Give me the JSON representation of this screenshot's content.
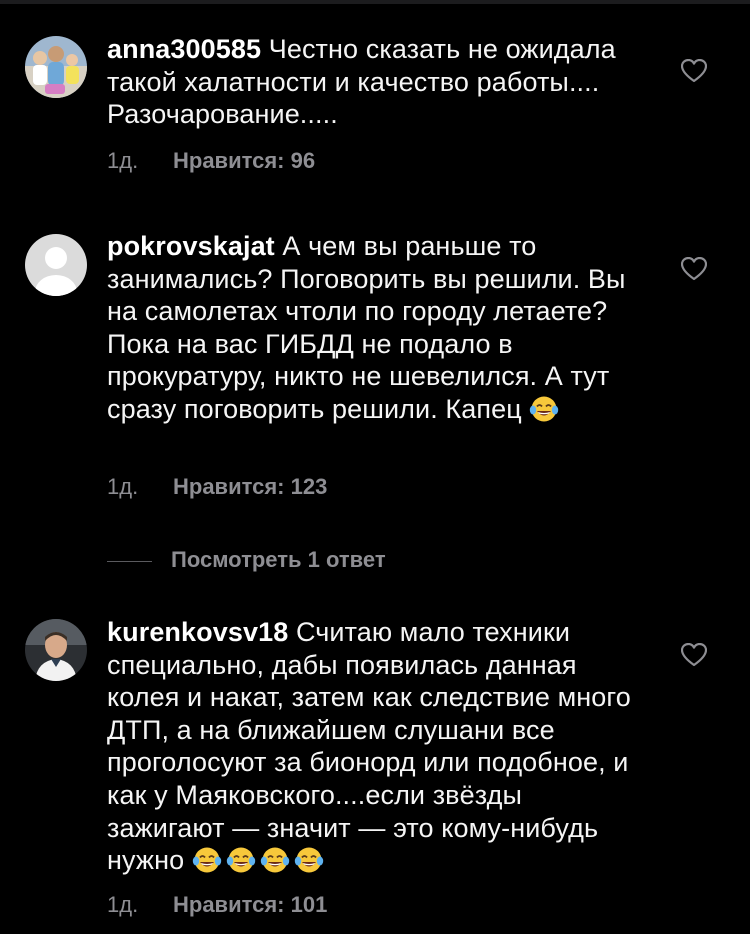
{
  "comments": [
    {
      "username": "anna300585",
      "text": "Честно сказать не ожидала такой халатности и качество работы.... Разочарование.....",
      "time": "1д.",
      "likes": "Нравится: 96",
      "avatar": "family-photo"
    },
    {
      "username": "pokrovskajat",
      "text": "А чем вы раньше то занимались? Поговорить вы решили. Вы на самолетах чтоли по городу летаете? Пока на вас ГИБДД не подало в прокуратуру, никто не шевелился. А тут сразу поговорить решили. Капец",
      "emoji_count": 1,
      "time": "1д.",
      "likes": "Нравится: 123",
      "avatar": "default-avatar"
    },
    {
      "username": "kurenkovsv18",
      "text": "Считаю мало техники специально, дабы появилась данная колея и накат, затем как следствие много ДТП, а на ближайшем слушани все проголосуют за бионорд или подобное, и как у Маяковского....если звёзды зажигают — значит — это кому-нибудь нужно",
      "emoji_count": 4,
      "time": "1д.",
      "likes": "Нравится: 101",
      "avatar": "man-in-car-photo"
    }
  ],
  "replies": {
    "label": "Посмотреть 1 ответ"
  },
  "icons": {
    "like": "heart-outline-icon",
    "emoji": "face-with-tears-of-joy"
  },
  "colors": {
    "background": "#000000",
    "text": "#ffffff",
    "secondary": "#8e8e93"
  }
}
